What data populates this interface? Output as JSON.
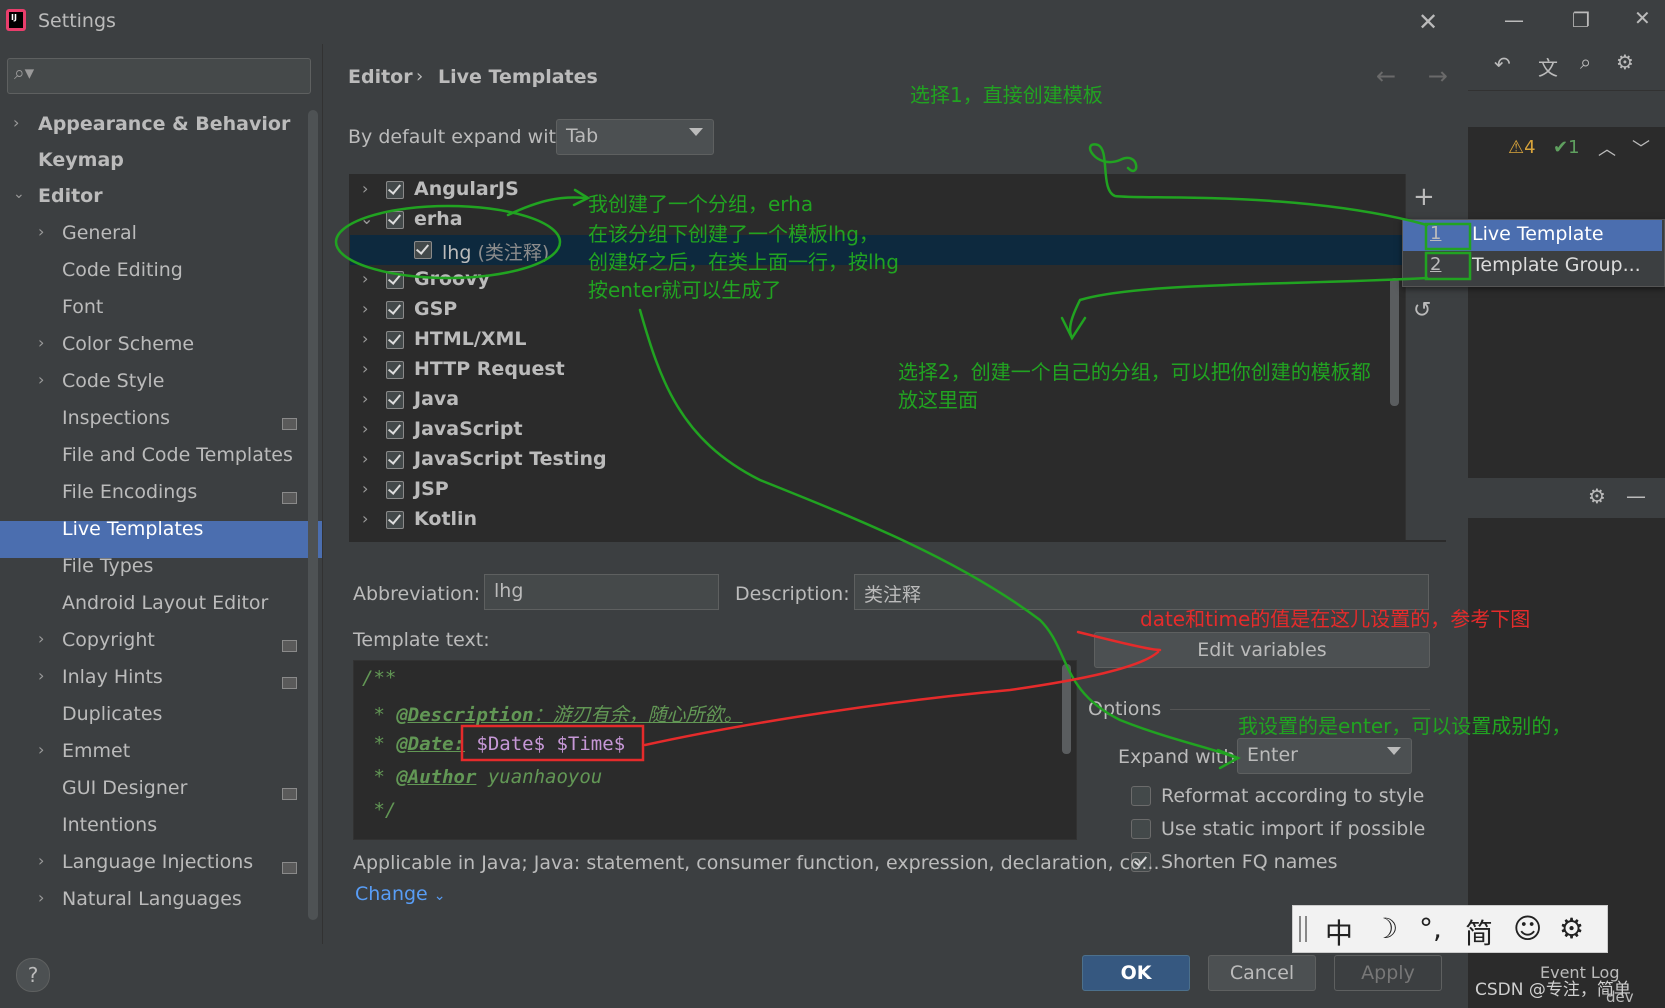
{
  "window": {
    "title": "Settings",
    "close": "✕"
  },
  "search": {
    "placeholder": ""
  },
  "sidebar": {
    "items": [
      {
        "label": "Appearance & Behavior"
      },
      {
        "label": "Keymap"
      },
      {
        "label": "Editor"
      },
      {
        "label": "General"
      },
      {
        "label": "Code Editing"
      },
      {
        "label": "Font"
      },
      {
        "label": "Color Scheme"
      },
      {
        "label": "Code Style"
      },
      {
        "label": "Inspections"
      },
      {
        "label": "File and Code Templates"
      },
      {
        "label": "File Encodings"
      },
      {
        "label": "Live Templates"
      },
      {
        "label": "File Types"
      },
      {
        "label": "Android Layout Editor"
      },
      {
        "label": "Copyright"
      },
      {
        "label": "Inlay Hints"
      },
      {
        "label": "Duplicates"
      },
      {
        "label": "Emmet"
      },
      {
        "label": "GUI Designer"
      },
      {
        "label": "Intentions"
      },
      {
        "label": "Language Injections"
      },
      {
        "label": "Natural Languages"
      }
    ]
  },
  "breadcrumb": {
    "parent": "Editor",
    "separator": "›",
    "current": "Live Templates"
  },
  "nav_arrows": "← →",
  "expand": {
    "label": "By default expand with",
    "value": "Tab"
  },
  "tree": {
    "rows": [
      {
        "label": "AngularJS"
      },
      {
        "label": "erha"
      },
      {
        "label": "lhg",
        "desc": "(类注释)"
      },
      {
        "label": "Groovy"
      },
      {
        "label": "GSP"
      },
      {
        "label": "HTML/XML"
      },
      {
        "label": "HTTP Request"
      },
      {
        "label": "Java"
      },
      {
        "label": "JavaScript"
      },
      {
        "label": "JavaScript Testing"
      },
      {
        "label": "JSP"
      },
      {
        "label": "Kotlin"
      }
    ]
  },
  "popup": {
    "items": [
      {
        "num": "1",
        "label": "Live Template"
      },
      {
        "num": "2",
        "label": "Template Group..."
      }
    ]
  },
  "form": {
    "abbreviation_label": "Abbreviation:",
    "abbreviation_value": "lhg",
    "description_label": "Description:",
    "description_value": "类注释",
    "template_text_label": "Template text:",
    "code": {
      "l1": "/**",
      "l2_tag": "@Description",
      "l2_rest": "：游刃有余，随心所欲。",
      "l3_tag": "@Date:",
      "l3_vars": "$Date$ $Time$",
      "l4_tag": "@Author",
      "l4_rest": " yuanhaoyou",
      "l5": "*/"
    },
    "edit_variables": "Edit variables",
    "options_label": "Options",
    "expand_with_label": "Expand with",
    "expand_with_value": "Enter",
    "reformat": "Reformat according to style",
    "static_import": "Use static import if possible",
    "shorten_fq": "Shorten FQ names",
    "applicable": "Applicable in Java; Java: statement, consumer function, expression, declaration, co...",
    "change": "Change"
  },
  "buttons": {
    "help": "?",
    "ok": "OK",
    "cancel": "Cancel",
    "apply": "Apply"
  },
  "ime": {
    "t1": "中",
    "t2": "☽",
    "t3": "°,",
    "t4": "简",
    "t5": "☺",
    "t6": "⚙"
  },
  "ide": {
    "warn": "⚠4",
    "check": "✔1",
    "event_log": "Event Log",
    "dev": "dev"
  },
  "annotations": {
    "a1": "选择1，直接创建模板",
    "a2_l1": "我创建了一个分组，erha",
    "a2_l2": "在该分组下创建了一个模板lhg，",
    "a2_l3": "创建好之后，在类上面一行，按lhg",
    "a2_l4": "按enter就可以生成了",
    "a3_l1": "选择2，创建一个自己的分组，可以把你创建的模板都",
    "a3_l2": "放这里面",
    "a4": "date和time的值是在这儿设置的，参考下图",
    "a5": "我设置的是enter，可以设置成别的，"
  },
  "watermark": "CSDN @专注，简单",
  "colors": {
    "accent": "#4b6eaf",
    "annotation_green": "#21a321",
    "annotation_red": "#e52b2b"
  }
}
